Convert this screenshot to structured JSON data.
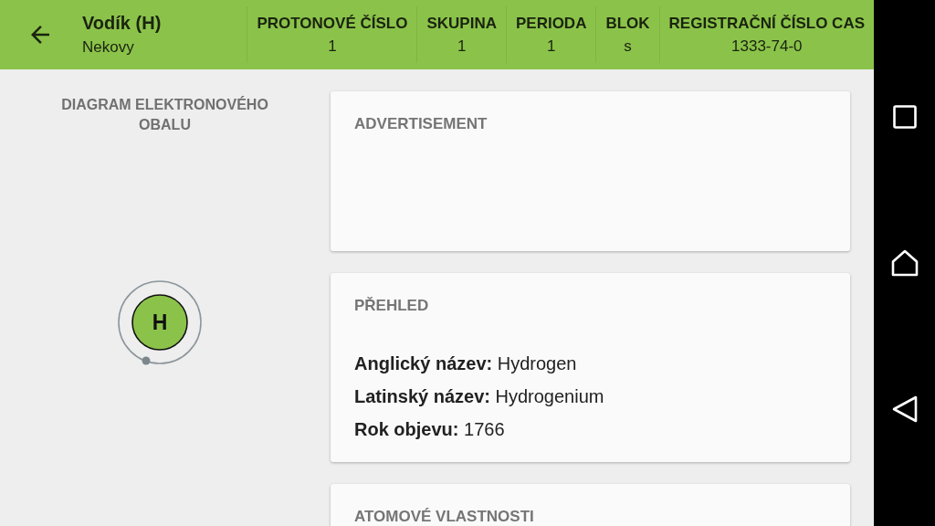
{
  "app_bar": {
    "title": "Vodík (H)",
    "subtitle": "Nekovy",
    "columns": [
      {
        "label": "PROTONOVÉ ČÍSLO",
        "value": "1"
      },
      {
        "label": "SKUPINA",
        "value": "1"
      },
      {
        "label": "PERIODA",
        "value": "1"
      },
      {
        "label": "BLOK",
        "value": "s"
      },
      {
        "label": "REGISTRAČNÍ ČÍSLO CAS",
        "value": "1333-74-0"
      }
    ]
  },
  "diagram": {
    "title": "DIAGRAM ELEKTRONOVÉHO OBALU",
    "symbol": "H"
  },
  "cards": [
    {
      "kind": "ad",
      "title": "ADVERTISEMENT"
    },
    {
      "kind": "facts",
      "title": "PŘEHLED",
      "facts": [
        "**Anglický název:** Hydrogen",
        "**Latinský název:** Hydrogenium",
        "**Rok objevu:** 1766"
      ]
    },
    {
      "kind": "facts",
      "title": "ATOMOVÉ VLASTNOSTI"
    }
  ]
}
